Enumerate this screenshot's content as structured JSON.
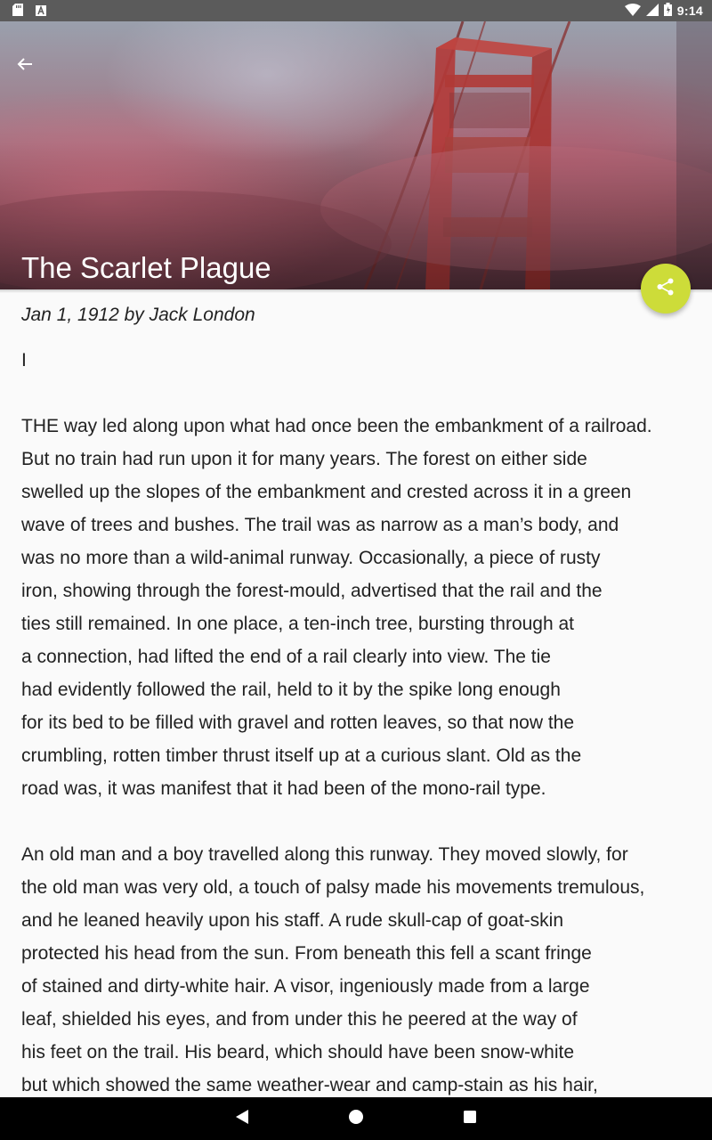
{
  "status_bar": {
    "time": "9:14",
    "left_icons": [
      "sd-card-icon",
      "keyboard-icon"
    ],
    "right_icons": [
      "wifi-icon",
      "signal-icon",
      "battery-icon"
    ]
  },
  "header": {
    "title": "The Scarlet Plague",
    "back_icon": "arrow-back-icon",
    "share_icon": "share-icon",
    "fab_color": "#cddc39"
  },
  "article": {
    "byline": "Jan 1, 1912 by Jack London",
    "lines": [
      "I",
      "",
      "THE way led along upon what had once been the embankment of a railroad.",
      "But no train had run upon it for many years. The forest on either side",
      "swelled up the slopes of the embankment and crested across it in a green",
      "wave of trees and bushes. The trail was as narrow as a man’s body, and",
      "was no more than a wild-animal runway. Occasionally, a piece of rusty",
      "iron, showing through the forest-mould, advertised that the rail and the",
      "ties still remained. In one place, a ten-inch tree, bursting through at",
      "a connection, had lifted the end of a rail clearly into view. The tie",
      "had evidently followed the rail, held to it by the spike long enough",
      "for its bed to be filled with gravel and rotten leaves, so that now the",
      "crumbling, rotten timber thrust itself up at a curious slant. Old as the",
      "road was, it was manifest that it had been of the mono-rail type.",
      "",
      "An old man and a boy travelled along this runway. They moved slowly, for",
      "the old man was very old, a touch of palsy made his movements tremulous,",
      "and he leaned heavily upon his staff. A rude skull-cap of goat-skin",
      "protected his head from the sun. From beneath this fell a scant fringe",
      "of stained and dirty-white hair. A visor, ingeniously made from a large",
      "leaf, shielded his eyes, and from under this he peered at the way of",
      "his feet on the trail. His beard, which should have been snow-white",
      "but which showed the same weather-wear and camp-stain as his hair,"
    ]
  },
  "nav_bar": {
    "icons": [
      "back-triangle-icon",
      "home-circle-icon",
      "recents-square-icon"
    ]
  }
}
